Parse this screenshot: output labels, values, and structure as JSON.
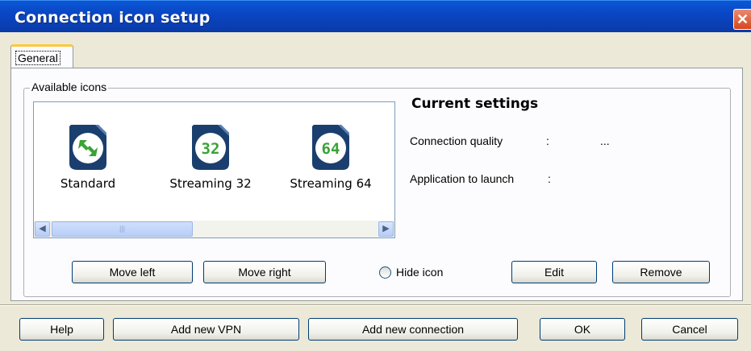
{
  "window": {
    "title": "Connection icon setup",
    "close_glyph": "✕"
  },
  "tabs": [
    {
      "label": "General",
      "active": true
    }
  ],
  "available_icons": {
    "group_label": "Available icons",
    "items": [
      {
        "label": "Standard",
        "icon": "double-arrow-icon",
        "badge": ""
      },
      {
        "label": "Streaming 32",
        "icon": "streaming-32-icon",
        "badge": "32"
      },
      {
        "label": "Streaming 64",
        "icon": "streaming-64-icon",
        "badge": "64"
      }
    ],
    "scrollbar": {
      "left_glyph": "◀",
      "right_glyph": "▶",
      "thumb_grip": "|||"
    }
  },
  "current_settings": {
    "title": "Current settings",
    "connection_quality": {
      "label": "Connection quality",
      "separator": ":",
      "value": "..."
    },
    "application_to_launch": {
      "label": "Application to launch",
      "separator": ":",
      "value": ""
    }
  },
  "icon_actions": {
    "move_left": "Move left",
    "move_right": "Move right",
    "hide_icon": "Hide icon",
    "edit": "Edit",
    "remove": "Remove"
  },
  "footer": {
    "help": "Help",
    "add_vpn": "Add new VPN",
    "add_connection": "Add new connection",
    "ok": "OK",
    "cancel": "Cancel"
  },
  "colors": {
    "titlebar": "#0a46c4",
    "icon_ring": "#1a3f6e",
    "icon_badge": "#3aa336",
    "dialog_bg": "#ece9d8"
  }
}
